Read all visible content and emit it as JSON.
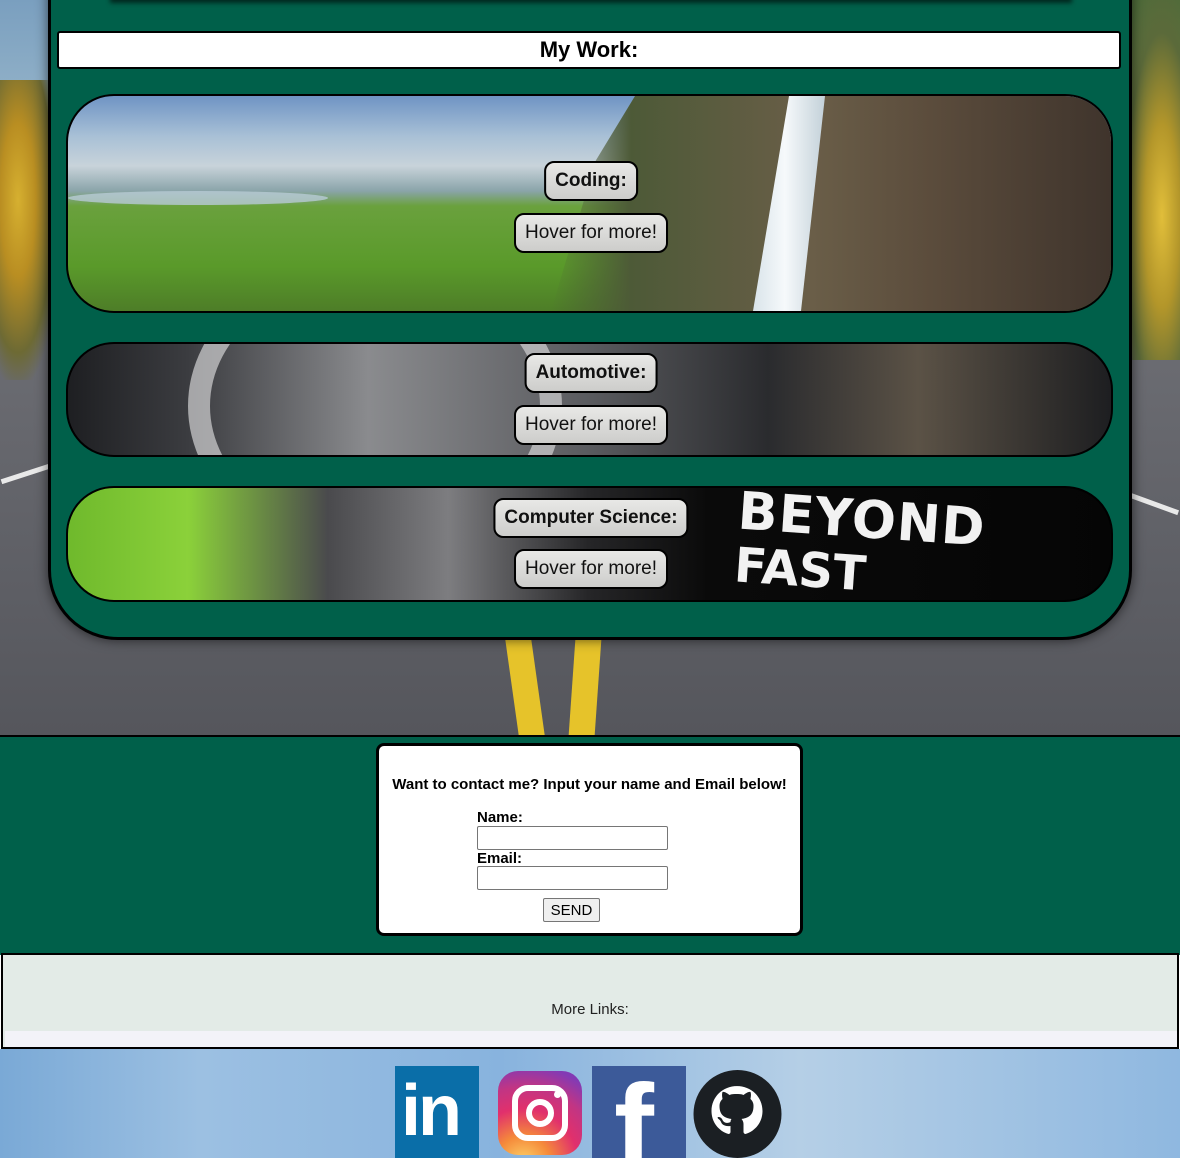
{
  "work": {
    "title": "My Work:",
    "cards": [
      {
        "label": "Coding:",
        "hover": "Hover for more!"
      },
      {
        "label": "Automotive:",
        "hover": "Hover for more!"
      },
      {
        "label": "Computer Science:",
        "hover": "Hover for more!",
        "image_text": [
          "BEYOND",
          "FAST"
        ]
      }
    ]
  },
  "contact": {
    "prompt": "Want to contact me? Input your name and Email below!",
    "name_label": "Name:",
    "name_value": "",
    "email_label": "Email:",
    "email_value": "",
    "send_label": "SEND"
  },
  "links": {
    "title": "More Links:",
    "items": [
      {
        "name": "LinkedIn",
        "icon": "linkedin-icon",
        "glyph": "in"
      },
      {
        "name": "Instagram",
        "icon": "instagram-icon"
      },
      {
        "name": "Facebook",
        "icon": "facebook-icon",
        "glyph": "f"
      },
      {
        "name": "GitHub",
        "icon": "github-icon"
      }
    ]
  },
  "colors": {
    "panel_green": "#00604a",
    "card_pill": "#dcdcda",
    "links_bg": "#e3ebe7",
    "linkedin_blue": "#0a6ea8",
    "facebook_blue": "#3c5a99"
  }
}
